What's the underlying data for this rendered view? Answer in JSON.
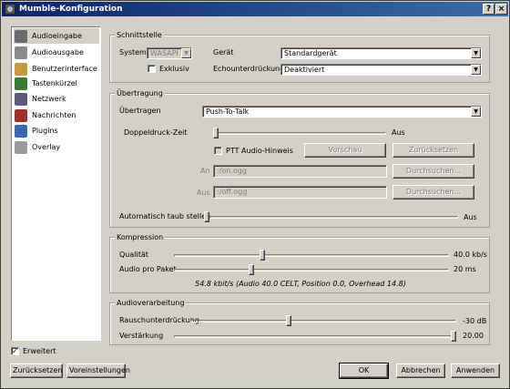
{
  "window": {
    "title": "Mumble-Konfiguration",
    "help_label": "?",
    "close_label": "×"
  },
  "sidebar": {
    "items": [
      {
        "label": "Audioeingabe",
        "icon": "microphone-icon",
        "color": "#6b6b6b"
      },
      {
        "label": "Audioausgabe",
        "icon": "speaker-icon",
        "color": "#8a8a8a"
      },
      {
        "label": "Benutzerinterface",
        "icon": "interface-icon",
        "color": "#c59a3a"
      },
      {
        "label": "Tastenkürzel",
        "icon": "keyboard-icon",
        "color": "#3a7a3a"
      },
      {
        "label": "Netzwerk",
        "icon": "network-icon",
        "color": "#5a5a7a"
      },
      {
        "label": "Nachrichten",
        "icon": "messages-icon",
        "color": "#a03030"
      },
      {
        "label": "Plugins",
        "icon": "plugins-icon",
        "color": "#3a6ab0"
      },
      {
        "label": "Overlay",
        "icon": "overlay-icon",
        "color": "#9a9a9a"
      }
    ],
    "selected_index": 0
  },
  "interface_group": {
    "title": "Schnittstelle",
    "system_label": "System",
    "system_value": "WASAPI",
    "device_label": "Gerät",
    "device_value": "Standardgerät",
    "exclusive_label": "Exklusiv",
    "exclusive_checked": false,
    "echo_label": "Echounterdrückung",
    "echo_value": "Deaktiviert"
  },
  "transmission_group": {
    "title": "Übertragung",
    "transmit_label": "Übertragen",
    "transmit_value": "Push-To-Talk",
    "double_push_label": "Doppeldruck-Zeit",
    "double_push_value_text": "Aus",
    "double_push_level": 0,
    "ptt_hint_label": "PTT Audio-Hinweis",
    "ptt_hint_checked": false,
    "preview_button": "Vorschau",
    "reset_button": "Zurücksetzen",
    "on_label": "An",
    "on_value": ":/on.ogg",
    "browse_on_button": "Durchsuchen...",
    "off_label": "Aus",
    "off_value": ":/off.ogg",
    "browse_off_button": "Durchsuchen...",
    "auto_deaf_label": "Automatisch taub stellen",
    "auto_deaf_value_text": "Aus",
    "auto_deaf_level": 0
  },
  "compression_group": {
    "title": "Kompression",
    "quality_label": "Qualität",
    "quality_value_text": "40.0 kb/s",
    "quality_level": 0.32,
    "packet_label": "Audio pro Paket",
    "packet_value_text": "20 ms",
    "packet_level": 0.28,
    "summary": "54.8 kbit/s (Audio 40.0 CELT, Position 0.0, Overhead 14.8)"
  },
  "processing_group": {
    "title": "Audioverarbeitung",
    "noise_label": "Rauschunterdrückung",
    "noise_value_text": "-30 dB",
    "noise_level": 0.37,
    "amp_label": "Verstärkung",
    "amp_value_text": "20.00",
    "amp_level": 0.99
  },
  "footer": {
    "advanced_label": "Erweitert",
    "advanced_checked": true,
    "reset_button": "Zurücksetzen",
    "defaults_button": "Voreinstellungen",
    "ok_button": "OK",
    "cancel_button": "Abbrechen",
    "apply_button": "Anwenden"
  }
}
